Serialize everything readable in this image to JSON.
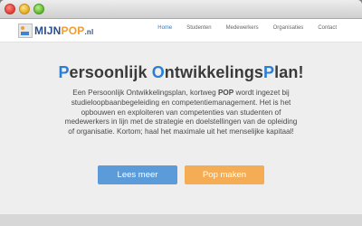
{
  "site": {
    "logo_text_1": "MIJN",
    "logo_text_2": "POP",
    "logo_text_3": ".nl"
  },
  "nav": {
    "items": [
      {
        "label": "Home",
        "active": true
      },
      {
        "label": "Studenten",
        "active": false
      },
      {
        "label": "Medewerkers",
        "active": false
      },
      {
        "label": "Organisaties",
        "active": false
      },
      {
        "label": "Contact",
        "active": false
      }
    ]
  },
  "hero": {
    "title_parts": [
      {
        "text": "P",
        "cap": true
      },
      {
        "text": "ersoonlijk ",
        "cap": false
      },
      {
        "text": "O",
        "cap": true
      },
      {
        "text": "ntwikkelings",
        "cap": false
      },
      {
        "text": "P",
        "cap": true
      },
      {
        "text": "lan!",
        "cap": false
      }
    ],
    "intro_1": "Een Persoonlijk Ontwikkelingsplan, kortweg ",
    "intro_bold": "POP",
    "intro_2": " wordt ingezet bij studieloopbaanbegeleiding en competentiemanagement. Het is het opbouwen en exploiteren van competenties van studenten of medewerkers in lijn met de strategie en doelstellingen van de opleiding of organisatie. Kortom; haal het maximale uit het menselijke kapitaal!",
    "button_primary": "Lees meer",
    "button_secondary": "Pop maken"
  },
  "colors": {
    "accent_blue": "#2b7ed5",
    "button_blue": "#5b9bd9",
    "button_orange": "#f4ad55"
  }
}
